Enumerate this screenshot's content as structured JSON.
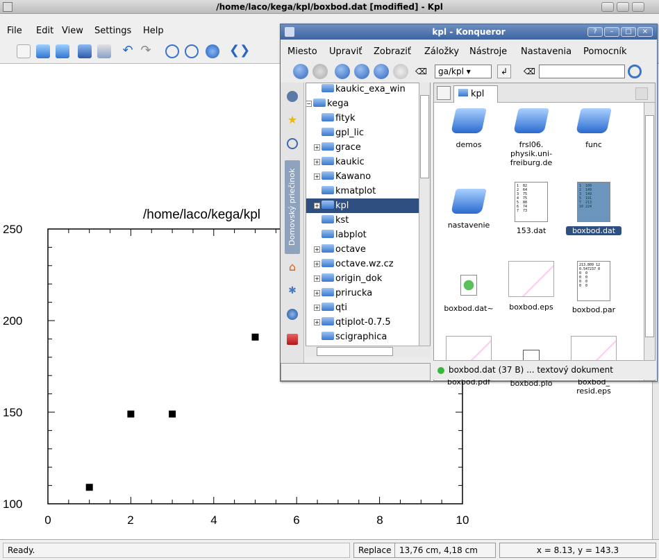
{
  "main": {
    "title": "/home/laco/kega/kpl/boxbod.dat [modified] - Kpl",
    "menu": [
      "File",
      "Edit",
      "View",
      "Settings",
      "Help"
    ],
    "status_ready": "Ready.",
    "status_mode": "Replace",
    "status_pos": "13,76 cm,  4,18 cm",
    "status_xy": "x = 8.13,  y = 143.3"
  },
  "plot": {
    "title": "/home/laco/kega/kpl",
    "x_ticks": [
      "0",
      "2",
      "4",
      "6",
      "8",
      "10"
    ],
    "y_ticks": [
      "100",
      "150",
      "200",
      "250"
    ]
  },
  "chart_data": {
    "type": "scatter",
    "title": "/home/laco/kega/kpl",
    "xlim": [
      0,
      10
    ],
    "ylim": [
      100,
      250
    ],
    "x": [
      1,
      2,
      3,
      5
    ],
    "y": [
      109,
      149,
      149,
      191
    ],
    "grid": false
  },
  "konq": {
    "title": "kpl - Konqueror",
    "menu": [
      "Miesto",
      "Upraviť",
      "Zobraziť",
      "Záložky",
      "Nástroje",
      "Nastavenia",
      "Pomocník"
    ],
    "location": "ga/kpl",
    "sidebar_tab": "Domovský priečinok",
    "tab_label": "kpl",
    "tree": [
      "kaukic_exa_win",
      "kega",
      "fityk",
      "gpl_lic",
      "grace",
      "kaukic",
      "Kawano",
      "kmatplot",
      "kpl",
      "kst",
      "labplot",
      "octave",
      "octave.wz.cz",
      "origin_dok",
      "prirucka",
      "qti",
      "qtiplot-0.7.5",
      "scigraphica"
    ],
    "files": [
      {
        "name": "demos"
      },
      {
        "name": "frsl06.\nphysik.uni-\nfreiburg.de"
      },
      {
        "name": "func"
      },
      {
        "name": "nastavenie"
      },
      {
        "name": "153.dat"
      },
      {
        "name": "boxbod.dat"
      },
      {
        "name": "boxbod.dat~"
      },
      {
        "name": "boxbod.eps"
      },
      {
        "name": "boxbod.par"
      },
      {
        "name": "boxbod.pdf"
      },
      {
        "name": "boxbod.plo"
      },
      {
        "name": "boxbod_\nresid.eps"
      }
    ],
    "doc_153": "1  82\n2  64\n3  75\n4  75\n5  88\n6  74\n7  73",
    "doc_boxbod": "1  109\n2  149\n3  149\n5  191\n7  213\n10 224",
    "doc_par": "213.809 12\n0.547237 0\n0  0\n0  0\n0  0\n0  0",
    "status": "boxbod.dat (37 B)  ... textový dokument"
  }
}
